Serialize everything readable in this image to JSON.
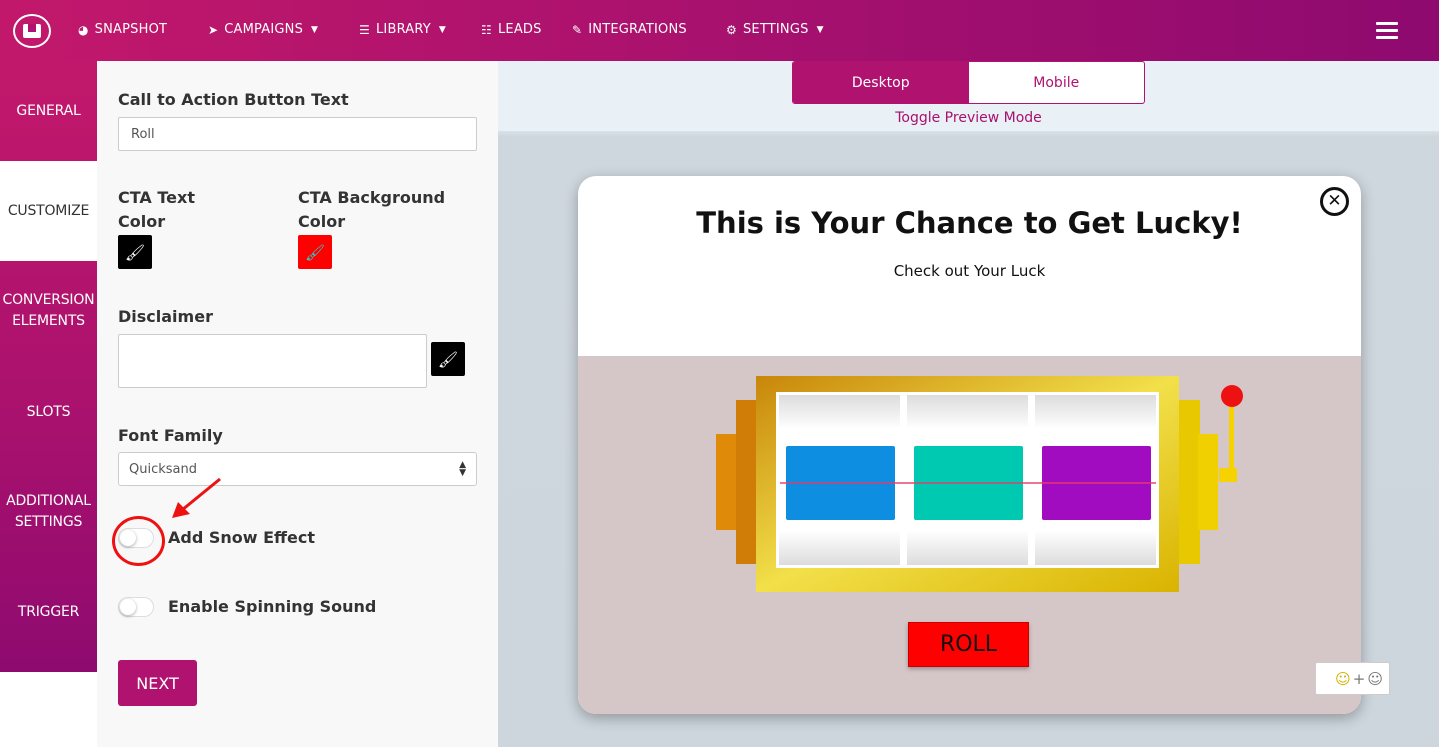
{
  "nav": {
    "items": [
      {
        "label": "SNAPSHOT",
        "icon": "dashboard-icon"
      },
      {
        "label": "CAMPAIGNS",
        "icon": "paper-plane-icon",
        "dropdown": true
      },
      {
        "label": "LIBRARY",
        "icon": "server-icon",
        "dropdown": true
      },
      {
        "label": "LEADS",
        "icon": "list-icon"
      },
      {
        "label": "INTEGRATIONS",
        "icon": "plug-icon"
      },
      {
        "label": "SETTINGS",
        "icon": "cogs-icon",
        "dropdown": true
      }
    ]
  },
  "sidebar": {
    "items": [
      {
        "label": "GENERAL"
      },
      {
        "label": "CUSTOMIZE",
        "active": true
      },
      {
        "label": "CONVERSION ELEMENTS"
      },
      {
        "label": "SLOTS"
      },
      {
        "label": "ADDITIONAL SETTINGS"
      },
      {
        "label": "TRIGGER"
      }
    ]
  },
  "form": {
    "cta_label": "Call to Action Button Text",
    "cta_value": "Roll",
    "cta_text_color_label": "CTA Text Color",
    "cta_text_color": "#000000",
    "cta_bg_color_label": "CTA Background Color",
    "cta_bg_color": "#ff0000",
    "disclaimer_label": "Disclaimer",
    "disclaimer_value": "",
    "font_family_label": "Font Family",
    "font_family_value": "Quicksand",
    "snow_label": "Add Snow Effect",
    "snow_enabled": false,
    "sound_label": "Enable Spinning Sound",
    "sound_enabled": false,
    "next_label": "NEXT"
  },
  "preview": {
    "desktop_label": "Desktop",
    "mobile_label": "Mobile",
    "active_mode": "Desktop",
    "caption": "Toggle Preview Mode"
  },
  "modal": {
    "title": "This is Your Chance to Get Lucky!",
    "subtitle": "Check out Your Luck",
    "roll_label": "ROLL",
    "close_icon": "close-icon",
    "reel_colors": [
      "#0d8ee0",
      "#00c9b1",
      "#a10cc0"
    ]
  },
  "colors": {
    "brand": "#b01270",
    "brand_dark": "#8e0a6f",
    "annotation": "#e11111"
  }
}
